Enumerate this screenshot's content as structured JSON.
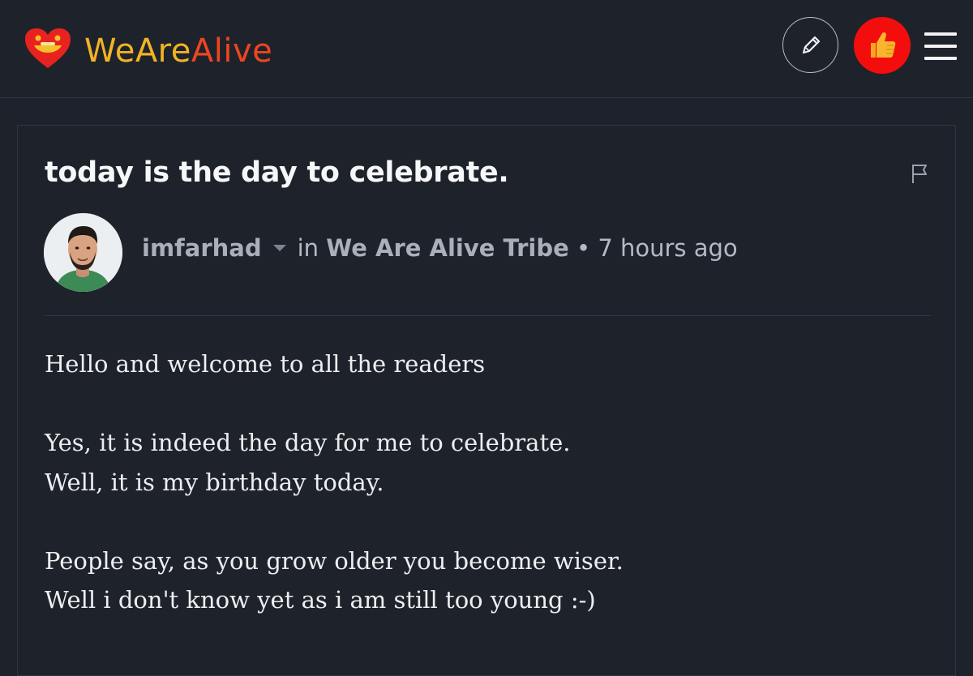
{
  "header": {
    "logo_text_part1": "WeAre",
    "logo_text_part2": "Alive",
    "logo_colors": {
      "part1": "#f2b324",
      "part2": "#ee4520",
      "heart": "#e8231f"
    },
    "icons": {
      "edit": "pencil-icon",
      "vote": "thumbs-up-icon",
      "menu": "hamburger-menu-icon"
    },
    "vote_color": "#f40d0d"
  },
  "post": {
    "title": "today is the day to celebrate.",
    "author": "imfarhad",
    "in_label": "in",
    "community": "We Are Alive Tribe",
    "separator": "•",
    "time_ago": "7 hours ago",
    "flag_icon": "flag-icon",
    "body": {
      "line1": "Hello and welcome to all the readers",
      "line2": "Yes, it is indeed the day for me to celebrate.",
      "line3": "Well, it is my birthday today.",
      "line4": "People say, as you grow older you become wiser.",
      "line5": "Well i don't know yet as i am still too young :-)"
    }
  }
}
